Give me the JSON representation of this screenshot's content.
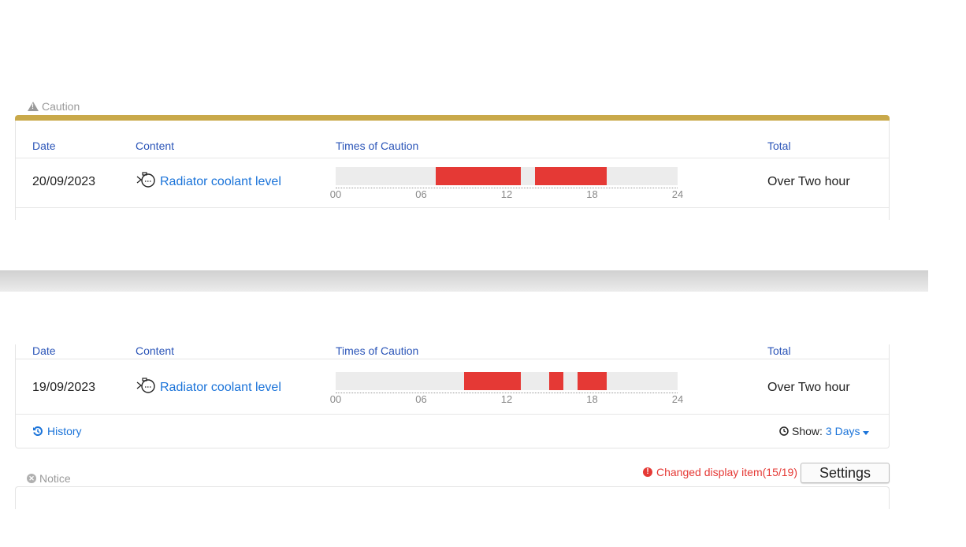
{
  "caution_tab": {
    "label": "Caution",
    "icon": "warning-icon"
  },
  "headers": {
    "date": "Date",
    "content": "Content",
    "times": "Times of Caution",
    "total": "Total"
  },
  "axis_ticks": [
    "00",
    "06",
    "12",
    "18",
    "24"
  ],
  "rows": [
    {
      "date": "20/09/2023",
      "content": "Radiator coolant level",
      "total": "Over Two hour",
      "caution_intervals_hours": [
        [
          7.0,
          13.0
        ],
        [
          14.0,
          19.0
        ]
      ]
    },
    {
      "date": "19/09/2023",
      "content": "Radiator coolant level",
      "total": "Over Two hour",
      "caution_intervals_hours": [
        [
          9.0,
          13.0
        ],
        [
          15.0,
          16.0
        ],
        [
          17.0,
          19.0
        ]
      ]
    }
  ],
  "footer": {
    "history_label": "History",
    "show_label": "Show:",
    "show_value": "3 Days"
  },
  "notice_tab": {
    "label": "Notice",
    "icon": "x-circle-icon"
  },
  "changed_display": "Changed display item(15/19)",
  "settings_label": "Settings",
  "colors": {
    "accent": "#c9a94a",
    "alert": "#e53935",
    "link": "#1a73d9",
    "header": "#2b55b8"
  }
}
